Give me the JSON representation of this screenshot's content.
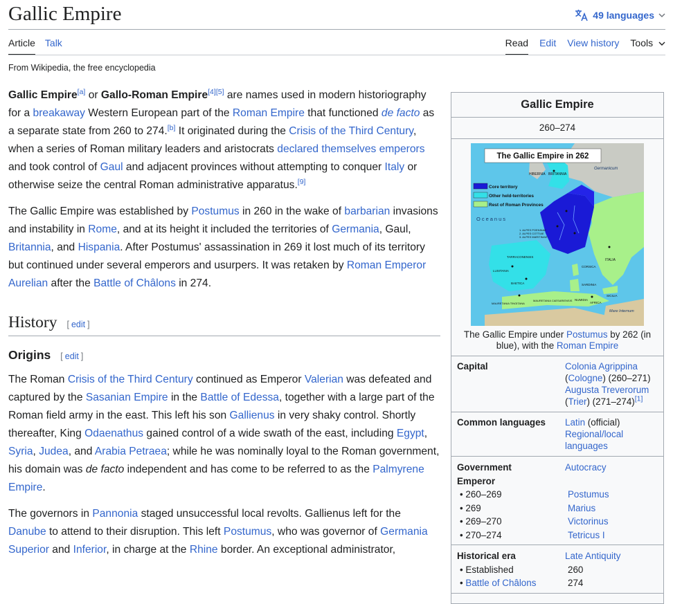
{
  "page": {
    "title": "Gallic Empire",
    "languages": "49 languages",
    "tagline": "From Wikipedia, the free encyclopedia"
  },
  "tabs": {
    "article": "Article",
    "talk": "Talk",
    "read": "Read",
    "edit": "Edit",
    "history": "View history",
    "tools": "Tools"
  },
  "icons": {
    "language": "translate-icon",
    "dropdown": "chevron-down-icon"
  },
  "colors": {
    "link": "#3366cc",
    "text": "#202122",
    "infobox_bg": "#f8f9fa",
    "border": "#a2a9b1"
  },
  "intro": {
    "p1": {
      "s1": "Gallic Empire",
      "r1": "[a]",
      "s2": " or ",
      "s3": "Gallo-Roman Empire",
      "r2": "[4]",
      "r3": "[5]",
      "s4": " are names used in modern historiography for a ",
      "l1": "breakaway",
      "s5": " Western European part of the ",
      "l2": "Roman Empire",
      "s6": " that functioned ",
      "l3": "de facto",
      "s7": " as a separate state from 260 to 274.",
      "r4": "[b]",
      "s8": " It originated during the ",
      "l4": "Crisis of the Third Century",
      "s9": ", when a series of Roman military leaders and aristocrats ",
      "l5": "declared themselves emperors",
      "s10": " and took control of ",
      "l6": "Gaul",
      "s11": " and adjacent provinces without attempting to conquer ",
      "l7": "Italy",
      "s12": " or otherwise seize the central Roman administrative apparatus.",
      "r5": "[9]"
    },
    "p2": {
      "s1": "The Gallic Empire was established by ",
      "l1": "Postumus",
      "s2": " in 260 in the wake of ",
      "l2": "barbarian",
      "s3": " invasions and instability in ",
      "l3": "Rome",
      "s4": ", and at its height it included the territories of ",
      "l4": "Germania",
      "s5": ", Gaul, ",
      "l5": "Britannia",
      "s6": ", and ",
      "l6": "Hispania",
      "s7": ". After Postumus' assassination in 269 it lost much of its territory but continued under several emperors and usurpers. It was retaken by ",
      "l7": "Roman Emperor Aurelian",
      "s8": " after the ",
      "l8": "Battle of Châlons",
      "s9": " in 274."
    }
  },
  "history": {
    "heading": "History",
    "edit_open": "[",
    "edit_label": "edit",
    "edit_close": "]"
  },
  "origins": {
    "heading": "Origins",
    "edit_open": "[",
    "edit_label": "edit",
    "edit_close": "]",
    "p1": {
      "s1": "The Roman ",
      "l1": "Crisis of the Third Century",
      "s2": " continued as Emperor ",
      "l2": "Valerian",
      "s3": " was defeated and captured by the ",
      "l3": "Sasanian Empire",
      "s4": " in the ",
      "l4": "Battle of Edessa",
      "s5": ", together with a large part of the Roman field army in the east. This left his son ",
      "l5": "Gallienus",
      "s6": " in very shaky control. Shortly thereafter, King ",
      "l6": "Odaenathus",
      "s7": " gained control of a wide swath of the east, including ",
      "l7": "Egypt",
      "s8": ", ",
      "l8": "Syria",
      "s9": ", ",
      "l9": "Judea",
      "s10": ", and ",
      "l10": "Arabia Petraea",
      "s11": "; while he was nominally loyal to the Roman government, his domain was ",
      "i1": "de facto",
      "s12": " independent and has come to be referred to as the ",
      "l11": "Palmyrene Empire",
      "s13": "."
    },
    "p2": {
      "s1": "The governors in ",
      "l1": "Pannonia",
      "s2": " staged unsuccessful local revolts. Gallienus left for the ",
      "l2": "Danube",
      "s3": " to attend to their disruption. This left ",
      "l3": "Postumus",
      "s4": ", who was governor of ",
      "l4": "Germania Superior",
      "s5": " and ",
      "l5": "Inferior",
      "s6": ", in charge at the ",
      "l6": "Rhine",
      "s7": " border. An exceptional administrator,"
    }
  },
  "infobox": {
    "title": "Gallic Empire",
    "dates": "260–274",
    "map": {
      "title": "The Gallic Empire in 262",
      "legend": [
        "Core territory",
        "Other held-territories",
        "Rest of Roman Provinces"
      ],
      "legend_colors": [
        "#1a1ad6",
        "#33e0e8",
        "#a8f08a"
      ],
      "labels": [
        "Oceanus",
        "HIBERNIA",
        "BRITANNIA",
        "Germanicum",
        "ITALIA",
        "CORSICA",
        "SARDINIA",
        "SICILIA",
        "TARRACONENSIS",
        "LUSITANIA",
        "BAETICA",
        "MAURETANIA TINGITANA",
        "MAURETANIA CAESARIENSIS",
        "NUMIDIA",
        "AFRICA",
        "Mare Internum",
        "1. ALPES POENINAE",
        "2. ALPES COTTIAE",
        "3. ALPES MARITIMAE"
      ]
    },
    "caption": {
      "s1": "The Gallic Empire under ",
      "l1": "Postumus",
      "s2": " by 262 (in blue), with the ",
      "l2": "Roman Empire"
    },
    "capital": {
      "label": "Capital",
      "l1": "Colonia Agrippina",
      "s1": "(",
      "l2": "Cologne",
      "s2": ") (260–271)",
      "l3": "Augusta Treverorum",
      "s3": "(",
      "l4": "Trier",
      "s4": ") (271–274)",
      "r1": "[1]"
    },
    "languages": {
      "label": "Common languages",
      "l1": "Latin",
      "s1": " (official)",
      "l2": "Regional/local languages"
    },
    "government": {
      "label": "Government",
      "value": "Autocracy",
      "emperor_label": "Emperor",
      "emperors": [
        {
          "period": "• 260–269",
          "name": "Postumus"
        },
        {
          "period": "• 269",
          "name": "Marius"
        },
        {
          "period": "• 269–270",
          "name": "Victorinus"
        },
        {
          "period": "• 270–274",
          "name": "Tetricus I"
        }
      ]
    },
    "era": {
      "label": "Historical era",
      "value": "Late Antiquity",
      "events": [
        {
          "bullet": "• ",
          "name": "Established",
          "link": false,
          "year": "260"
        },
        {
          "bullet": "• ",
          "name": "Battle of Châlons",
          "link": true,
          "year": "274"
        }
      ]
    }
  }
}
